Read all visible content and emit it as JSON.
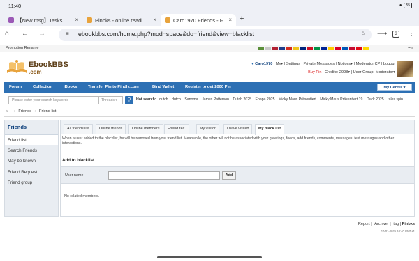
{
  "status": {
    "time": "11:40",
    "battery": "55"
  },
  "tabs": [
    {
      "title": "【New msg】Tasks",
      "fav": "#9b59b6"
    },
    {
      "title": "Pinbks - online readi",
      "fav": "#e8a33c"
    },
    {
      "title": "Caro1970 Friends - F",
      "fav": "#e8a33c"
    }
  ],
  "browser": {
    "url": "ebookbbs.com/home.php?mod=space&do=friend&view=blacklist",
    "tab_count": "3"
  },
  "site_top": {
    "links": "Promotion  Rename",
    "lang": "•• ≡"
  },
  "flag_colors": [
    "#5b8f3a",
    "#c8c8c8",
    "#b22234",
    "#1f3d8a",
    "#d52b1e",
    "#f0c419",
    "#00247d",
    "#ce1126",
    "#009246",
    "#002395",
    "#ffcc00",
    "#d80027",
    "#0057b7",
    "#c60c30",
    "#e30a17",
    "#ffd700"
  ],
  "logo": {
    "name": "EbookBBS",
    "sub": ".com"
  },
  "user": {
    "name": "Caro1970",
    "my": "My",
    "settings": "Settings",
    "pm": "Private Messages",
    "notices": "Notices",
    "mod_cp": "Moderator CP",
    "logout": "Logout",
    "buy_pin": "Buy Pin",
    "credits": "Credits: 2998",
    "group": "User Group: Moderator"
  },
  "nav": {
    "items": [
      "Forum",
      "Collection",
      "iBooks",
      "Transfer Pin to Pindly.com",
      "Bind Wallet",
      "Register to get 2000 Pin"
    ],
    "my_center": "My Center"
  },
  "search": {
    "placeholder": "Please enter your search keywords",
    "scope": "Threads",
    "hot_label": "Hot search:",
    "hot": [
      "dutch",
      "dutch",
      "Sanoma",
      "James Patterson",
      "Dutch 2025",
      "Ehapa 2025",
      "Micky Maus Präsentiert",
      "Micky Maus Präsentiert 19",
      "Duck 2025",
      "tales spin"
    ]
  },
  "breadcrumb": [
    "Friends",
    "Friend list"
  ],
  "sidebar": {
    "title": "Friends",
    "items": [
      "Friend list",
      "Search Friends",
      "May be known",
      "Friend Request",
      "Friend group"
    ]
  },
  "friend_tabs": [
    "All friends list",
    "Online friends",
    "Online members",
    "Friend rec.",
    "My visitor",
    "I have visited",
    "My black list"
  ],
  "blacklist": {
    "notice": "When a user added to the blacklist, he will be removed from your friend list. Meanwhile, the other will not be associated with your greetings, feeds, add friends, comments, messages, text messages and other interactions.",
    "section_title": "Add to blacklist",
    "username_label": "User name",
    "add_label": "Add",
    "empty": "No related members."
  },
  "footer": {
    "links": [
      "Report",
      "Archiver",
      "tag",
      "Pinbks"
    ],
    "time": "10-01-2025 10:40 GMT+1"
  }
}
